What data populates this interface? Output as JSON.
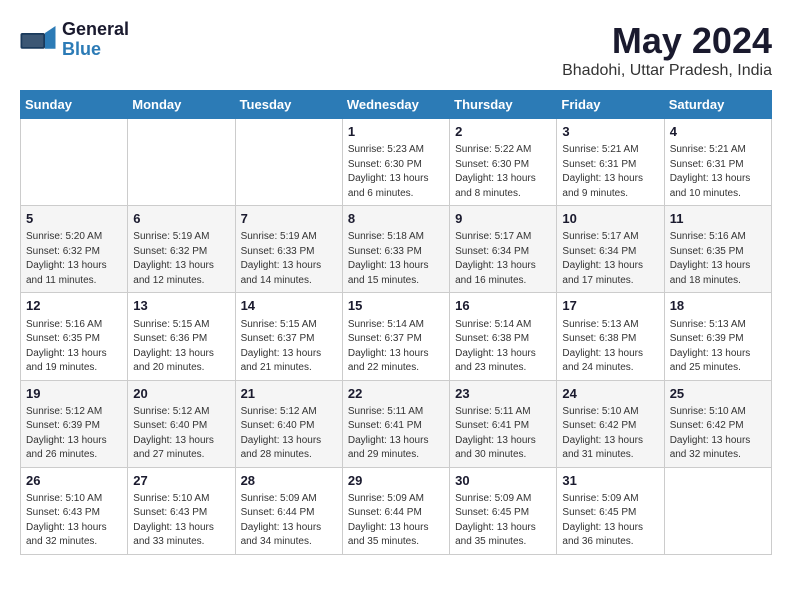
{
  "logo": {
    "line1": "General",
    "line2": "Blue"
  },
  "title": "May 2024",
  "subtitle": "Bhadohi, Uttar Pradesh, India",
  "weekdays": [
    "Sunday",
    "Monday",
    "Tuesday",
    "Wednesday",
    "Thursday",
    "Friday",
    "Saturday"
  ],
  "weeks": [
    [
      {
        "day": "",
        "info": ""
      },
      {
        "day": "",
        "info": ""
      },
      {
        "day": "",
        "info": ""
      },
      {
        "day": "1",
        "info": "Sunrise: 5:23 AM\nSunset: 6:30 PM\nDaylight: 13 hours\nand 6 minutes."
      },
      {
        "day": "2",
        "info": "Sunrise: 5:22 AM\nSunset: 6:30 PM\nDaylight: 13 hours\nand 8 minutes."
      },
      {
        "day": "3",
        "info": "Sunrise: 5:21 AM\nSunset: 6:31 PM\nDaylight: 13 hours\nand 9 minutes."
      },
      {
        "day": "4",
        "info": "Sunrise: 5:21 AM\nSunset: 6:31 PM\nDaylight: 13 hours\nand 10 minutes."
      }
    ],
    [
      {
        "day": "5",
        "info": "Sunrise: 5:20 AM\nSunset: 6:32 PM\nDaylight: 13 hours\nand 11 minutes."
      },
      {
        "day": "6",
        "info": "Sunrise: 5:19 AM\nSunset: 6:32 PM\nDaylight: 13 hours\nand 12 minutes."
      },
      {
        "day": "7",
        "info": "Sunrise: 5:19 AM\nSunset: 6:33 PM\nDaylight: 13 hours\nand 14 minutes."
      },
      {
        "day": "8",
        "info": "Sunrise: 5:18 AM\nSunset: 6:33 PM\nDaylight: 13 hours\nand 15 minutes."
      },
      {
        "day": "9",
        "info": "Sunrise: 5:17 AM\nSunset: 6:34 PM\nDaylight: 13 hours\nand 16 minutes."
      },
      {
        "day": "10",
        "info": "Sunrise: 5:17 AM\nSunset: 6:34 PM\nDaylight: 13 hours\nand 17 minutes."
      },
      {
        "day": "11",
        "info": "Sunrise: 5:16 AM\nSunset: 6:35 PM\nDaylight: 13 hours\nand 18 minutes."
      }
    ],
    [
      {
        "day": "12",
        "info": "Sunrise: 5:16 AM\nSunset: 6:35 PM\nDaylight: 13 hours\nand 19 minutes."
      },
      {
        "day": "13",
        "info": "Sunrise: 5:15 AM\nSunset: 6:36 PM\nDaylight: 13 hours\nand 20 minutes."
      },
      {
        "day": "14",
        "info": "Sunrise: 5:15 AM\nSunset: 6:37 PM\nDaylight: 13 hours\nand 21 minutes."
      },
      {
        "day": "15",
        "info": "Sunrise: 5:14 AM\nSunset: 6:37 PM\nDaylight: 13 hours\nand 22 minutes."
      },
      {
        "day": "16",
        "info": "Sunrise: 5:14 AM\nSunset: 6:38 PM\nDaylight: 13 hours\nand 23 minutes."
      },
      {
        "day": "17",
        "info": "Sunrise: 5:13 AM\nSunset: 6:38 PM\nDaylight: 13 hours\nand 24 minutes."
      },
      {
        "day": "18",
        "info": "Sunrise: 5:13 AM\nSunset: 6:39 PM\nDaylight: 13 hours\nand 25 minutes."
      }
    ],
    [
      {
        "day": "19",
        "info": "Sunrise: 5:12 AM\nSunset: 6:39 PM\nDaylight: 13 hours\nand 26 minutes."
      },
      {
        "day": "20",
        "info": "Sunrise: 5:12 AM\nSunset: 6:40 PM\nDaylight: 13 hours\nand 27 minutes."
      },
      {
        "day": "21",
        "info": "Sunrise: 5:12 AM\nSunset: 6:40 PM\nDaylight: 13 hours\nand 28 minutes."
      },
      {
        "day": "22",
        "info": "Sunrise: 5:11 AM\nSunset: 6:41 PM\nDaylight: 13 hours\nand 29 minutes."
      },
      {
        "day": "23",
        "info": "Sunrise: 5:11 AM\nSunset: 6:41 PM\nDaylight: 13 hours\nand 30 minutes."
      },
      {
        "day": "24",
        "info": "Sunrise: 5:10 AM\nSunset: 6:42 PM\nDaylight: 13 hours\nand 31 minutes."
      },
      {
        "day": "25",
        "info": "Sunrise: 5:10 AM\nSunset: 6:42 PM\nDaylight: 13 hours\nand 32 minutes."
      }
    ],
    [
      {
        "day": "26",
        "info": "Sunrise: 5:10 AM\nSunset: 6:43 PM\nDaylight: 13 hours\nand 32 minutes."
      },
      {
        "day": "27",
        "info": "Sunrise: 5:10 AM\nSunset: 6:43 PM\nDaylight: 13 hours\nand 33 minutes."
      },
      {
        "day": "28",
        "info": "Sunrise: 5:09 AM\nSunset: 6:44 PM\nDaylight: 13 hours\nand 34 minutes."
      },
      {
        "day": "29",
        "info": "Sunrise: 5:09 AM\nSunset: 6:44 PM\nDaylight: 13 hours\nand 35 minutes."
      },
      {
        "day": "30",
        "info": "Sunrise: 5:09 AM\nSunset: 6:45 PM\nDaylight: 13 hours\nand 35 minutes."
      },
      {
        "day": "31",
        "info": "Sunrise: 5:09 AM\nSunset: 6:45 PM\nDaylight: 13 hours\nand 36 minutes."
      },
      {
        "day": "",
        "info": ""
      }
    ]
  ]
}
